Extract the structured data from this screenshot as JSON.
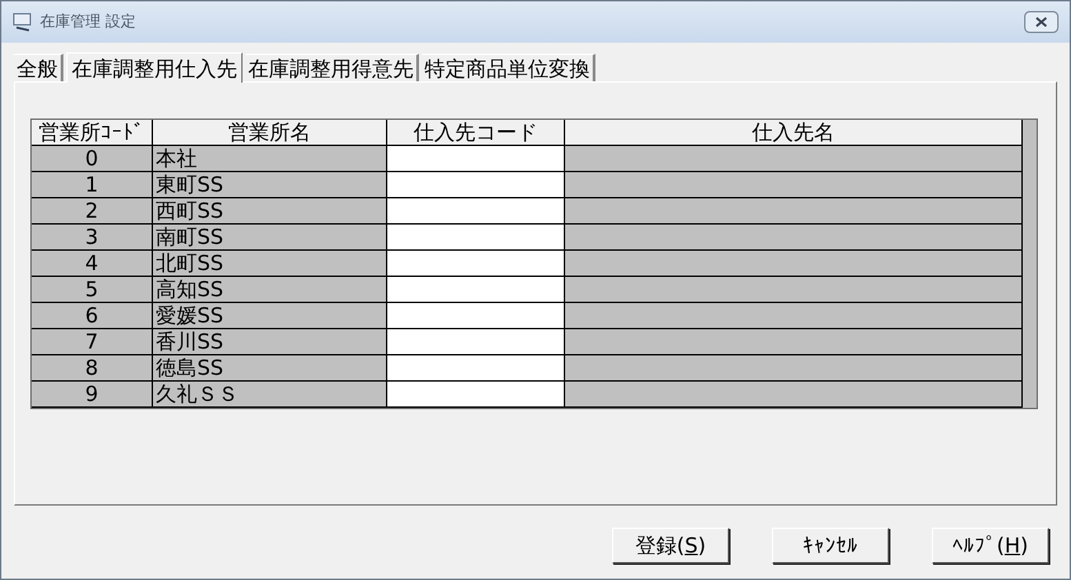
{
  "window": {
    "title": "在庫管理 設定"
  },
  "tabs": [
    {
      "label": "全般",
      "selected": false
    },
    {
      "label": "在庫調整用仕入先",
      "selected": true
    },
    {
      "label": "在庫調整用得意先",
      "selected": false
    },
    {
      "label": "特定商品単位変換",
      "selected": false
    }
  ],
  "table": {
    "columns": [
      "営業所ｺｰﾄﾞ",
      "営業所名",
      "仕入先コード",
      "仕入先名"
    ],
    "rows": [
      {
        "code": "0",
        "name": "本社"
      },
      {
        "code": "1",
        "name": "東町SS"
      },
      {
        "code": "2",
        "name": "西町SS"
      },
      {
        "code": "3",
        "name": "南町SS"
      },
      {
        "code": "4",
        "name": "北町SS"
      },
      {
        "code": "5",
        "name": "高知SS"
      },
      {
        "code": "6",
        "name": "愛媛SS"
      },
      {
        "code": "7",
        "name": "香川SS"
      },
      {
        "code": "8",
        "name": "徳島SS"
      },
      {
        "code": "9",
        "name": "久礼ＳＳ"
      }
    ]
  },
  "buttons": [
    {
      "before": "登録(",
      "mnemonic": "S",
      "after": ")"
    },
    {
      "before": "ｷｬﾝｾﾙ"
    },
    {
      "before": "ﾍﾙﾌﾟ(",
      "mnemonic": "H",
      "after": ")"
    }
  ]
}
